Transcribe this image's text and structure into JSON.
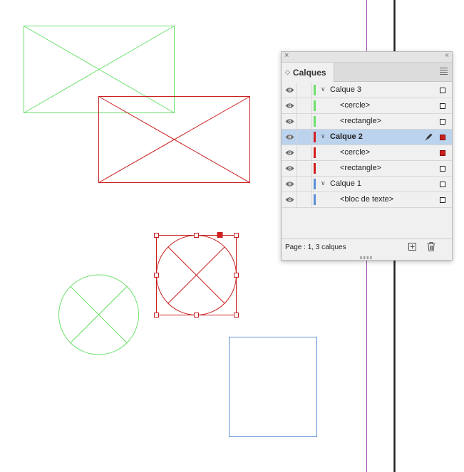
{
  "panel": {
    "close_glyph": "×",
    "collapse_glyph": "‹‹",
    "tab": {
      "chevron": "◇",
      "label": "Calques"
    },
    "menu_icon": "panel-menu-icon",
    "layers": [
      {
        "name": "Calque 3",
        "level": "parent",
        "color": "#6de06d",
        "expanded": true,
        "selected": false,
        "bold": false,
        "target_filled": false
      },
      {
        "name": "<cercle>",
        "level": "child",
        "color": "#6de06d",
        "selected": false,
        "bold": false,
        "target_filled": false
      },
      {
        "name": "<rectangle>",
        "level": "child",
        "color": "#6de06d",
        "selected": false,
        "bold": false,
        "target_filled": false
      },
      {
        "name": "Calque 2",
        "level": "parent",
        "color": "#d21e1e",
        "expanded": true,
        "selected": true,
        "bold": true,
        "target_filled": true,
        "pen": true
      },
      {
        "name": "<cercle>",
        "level": "child",
        "color": "#d21e1e",
        "selected": false,
        "bold": false,
        "target_filled": true
      },
      {
        "name": "<rectangle>",
        "level": "child",
        "color": "#d21e1e",
        "selected": false,
        "bold": false,
        "target_filled": false
      },
      {
        "name": "Calque 1",
        "level": "parent",
        "color": "#5c8fd6",
        "expanded": true,
        "selected": false,
        "bold": false,
        "target_filled": false
      },
      {
        "name": "<bloc de texte>",
        "level": "child",
        "color": "#5c8fd6",
        "selected": false,
        "bold": false,
        "target_filled": false
      }
    ],
    "footer": {
      "status": "Page : 1, 3 calques",
      "new_button_icon": "new-layer-icon",
      "delete_button_icon": "trash-icon"
    }
  },
  "colors": {
    "layer3_green": "#6de06d",
    "layer2_red": "#d21e1e",
    "layer1_blue": "#5c8fd6",
    "margin_guide": "#9b4aa8",
    "page_edge": "#222222",
    "selection_highlight": "#bcd3ee"
  }
}
